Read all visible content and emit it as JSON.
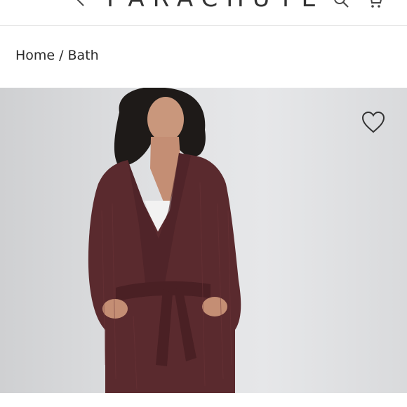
{
  "header": {
    "logo": "PARACHUTE",
    "icons": [
      "chevron-left-icon",
      "search-icon",
      "cart-icon"
    ]
  },
  "breadcrumb": {
    "home": "Home",
    "separator": "/",
    "current": "Bath"
  },
  "product": {
    "image": "woman-in-burgundy-robe",
    "robe_color": "#5a2a2e",
    "wishlist_icon": "heart-icon"
  },
  "colors": {
    "background": "#ffffff",
    "hero_bg": "#e2e3e5",
    "text": "#2b2b2b"
  }
}
